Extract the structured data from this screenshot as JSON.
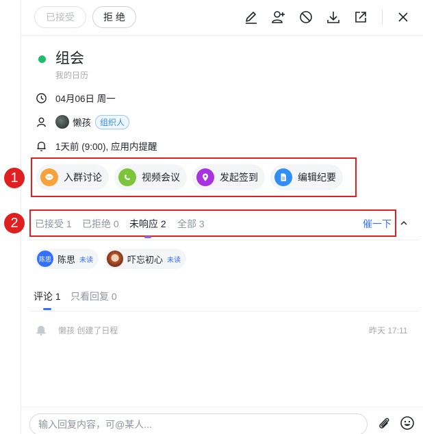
{
  "toolbar": {
    "accepted_label": "已接受",
    "reject_label": "拒 绝",
    "icons": [
      "edit-icon",
      "add-person-icon",
      "ban-icon",
      "download-icon",
      "share-external-icon",
      "close-icon"
    ]
  },
  "event": {
    "title": "组会",
    "calendar": "我的日历",
    "status_color": "#1fbd6b",
    "date": "04月06日 周一",
    "organizer_name": "懒孩",
    "organizer_tag": "组织人",
    "reminder": "1天前 (9:00), 应用内提醒"
  },
  "actions": [
    {
      "label": "入群讨论",
      "icon": "chat-icon",
      "color": "#f7a23b"
    },
    {
      "label": "视频会议",
      "icon": "video-call-icon",
      "color": "#7cc53a"
    },
    {
      "label": "发起签到",
      "icon": "location-pin-icon",
      "color": "#a832e0"
    },
    {
      "label": "编辑纪要",
      "icon": "document-icon",
      "color": "#2f8ff5"
    }
  ],
  "annotations": {
    "one": "1",
    "two": "2"
  },
  "responses": {
    "tabs": [
      {
        "label": "已接受",
        "count": "1"
      },
      {
        "label": "已拒绝",
        "count": "0"
      },
      {
        "label": "未响应",
        "count": "2"
      },
      {
        "label": "全部",
        "count": "3"
      }
    ],
    "remind_label": "催一下",
    "people": [
      {
        "name": "陈思",
        "avatar_text": "陈思",
        "status": "未读"
      },
      {
        "name": "吓忘初心",
        "avatar_text": "",
        "status": "未读"
      }
    ]
  },
  "comments": {
    "tabs": [
      {
        "label": "评论",
        "count": "1"
      },
      {
        "label": "只看回复",
        "count": "0"
      }
    ],
    "log": {
      "actor": "懒孩",
      "action": "创建了日程",
      "time": "昨天 17:11"
    }
  },
  "reply": {
    "placeholder": "输入回复内容，可@某人..."
  },
  "colors": {
    "accent": "#3370ff",
    "highlight_box": "#e02020"
  }
}
